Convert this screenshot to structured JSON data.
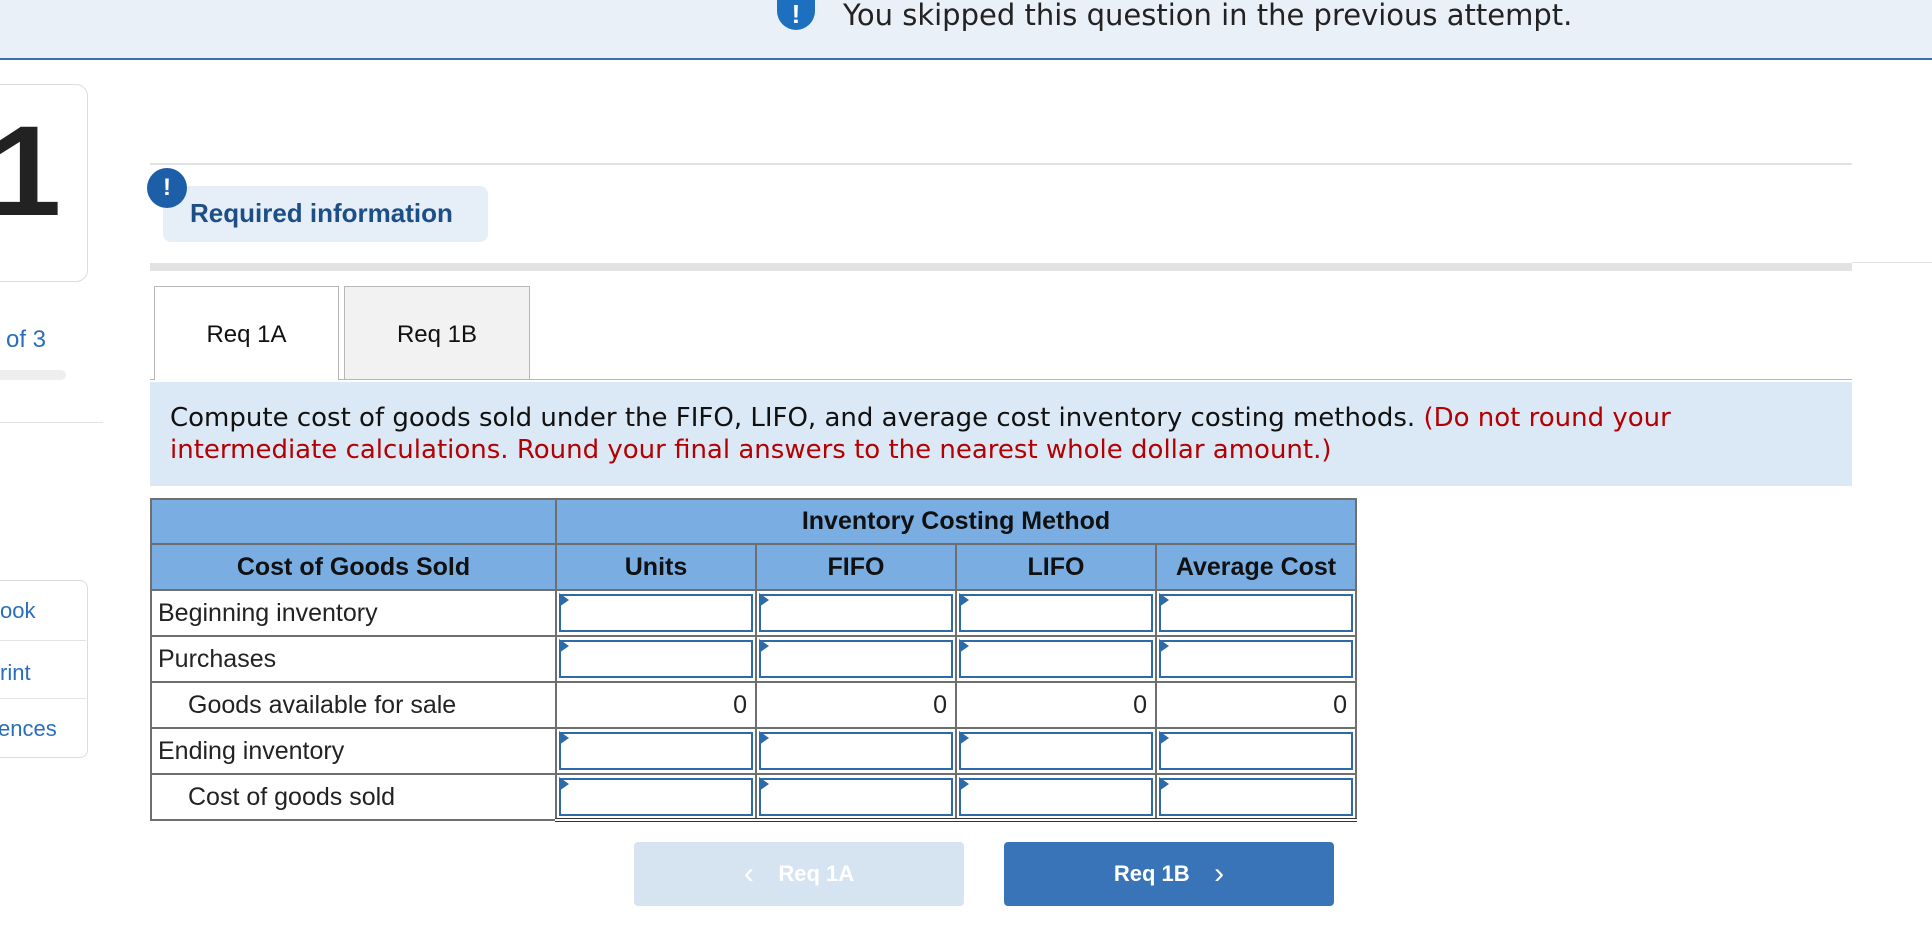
{
  "banner": {
    "icon": "exclamation-icon",
    "text": "You skipped this question in the previous attempt."
  },
  "sidebar": {
    "question_number": "1",
    "of_text": "of 3",
    "links": [
      {
        "label": "ook"
      },
      {
        "label": "rint"
      },
      {
        "label": "ences"
      }
    ]
  },
  "required_info": {
    "badge": "!",
    "label": "Required information"
  },
  "tabs": [
    {
      "label": "Req 1A",
      "active": true
    },
    {
      "label": "Req 1B",
      "active": false
    }
  ],
  "instructions": {
    "text": "Compute cost of goods sold under the FIFO, LIFO, and average cost inventory costing methods.",
    "note": "(Do not round your intermediate calculations. Round your final answers to the nearest whole dollar amount.)"
  },
  "table": {
    "group_header": "Inventory Costing Method",
    "headers": [
      "Cost of Goods Sold",
      "Units",
      "FIFO",
      "LIFO",
      "Average Cost"
    ],
    "rows": [
      {
        "label": "Beginning inventory",
        "values": [
          "",
          "",
          "",
          ""
        ]
      },
      {
        "label": "Purchases",
        "values": [
          "",
          "",
          "",
          ""
        ]
      },
      {
        "label": "Goods available for sale",
        "values": [
          "0",
          "0",
          "0",
          "0"
        ]
      },
      {
        "label": "Ending inventory",
        "values": [
          "",
          "",
          "",
          ""
        ]
      },
      {
        "label": "Cost of goods sold",
        "values": [
          "",
          "",
          "",
          ""
        ]
      }
    ]
  },
  "nav": {
    "prev_label": "Req 1A",
    "next_label": "Req 1B"
  },
  "colors": {
    "accent": "#3a74b8",
    "header_blue": "#7aaee3",
    "instruction_bg": "#dbe9f6",
    "note_red": "#b40000"
  }
}
